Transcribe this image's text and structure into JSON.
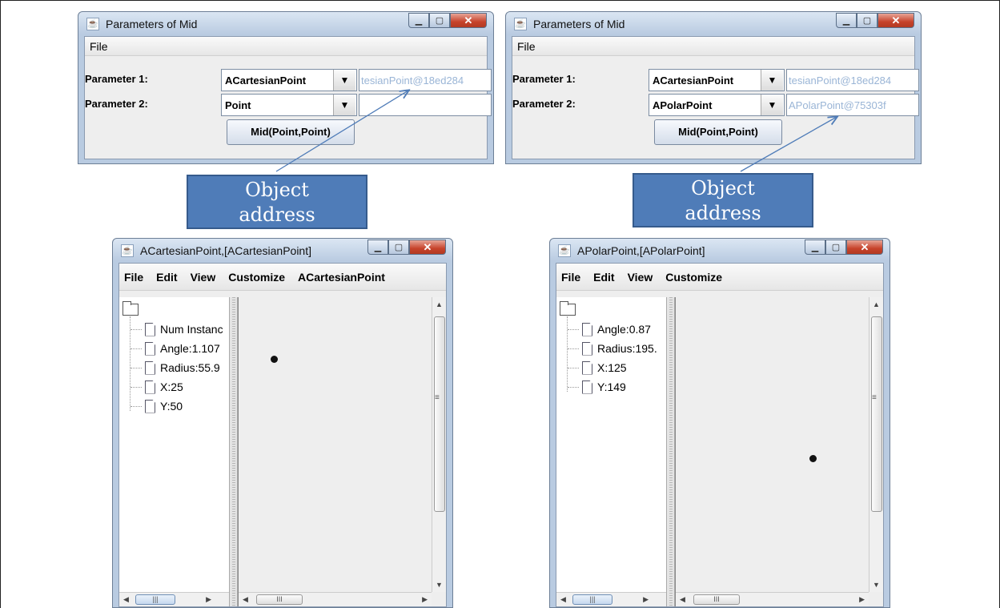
{
  "left_param_window": {
    "title": "Parameters of Mid",
    "menu": [
      "File"
    ],
    "param1_label": "Parameter 1:",
    "param1_value": "ACartesianPoint",
    "param1_address": "tesianPoint@18ed284",
    "param2_label": "Parameter 2:",
    "param2_value": "Point",
    "param2_address": "",
    "action_button": "Mid(Point,Point)"
  },
  "right_param_window": {
    "title": "Parameters of Mid",
    "menu": [
      "File"
    ],
    "param1_label": "Parameter 1:",
    "param1_value": "ACartesianPoint",
    "param1_address": "tesianPoint@18ed284",
    "param2_label": "Parameter 2:",
    "param2_value": "APolarPoint",
    "param2_address": "APolarPoint@75303f",
    "action_button": "Mid(Point,Point)"
  },
  "callouts": {
    "left": [
      "Object",
      "address"
    ],
    "right": [
      "Object",
      "address"
    ]
  },
  "cartesian_window": {
    "title": "ACartesianPoint,[ACartesianPoint]",
    "menu": [
      "File",
      "Edit",
      "View",
      "Customize",
      "ACartesianPoint"
    ],
    "tree_items": [
      "Num Instanc",
      "Angle:1.107",
      "Radius:55.9",
      "X:25",
      "Y:50"
    ]
  },
  "polar_window": {
    "title": "APolarPoint,[APolarPoint]",
    "menu": [
      "File",
      "Edit",
      "View",
      "Customize"
    ],
    "tree_items": [
      "Angle:0.87",
      "Radius:195.",
      "X:125",
      "Y:149"
    ]
  },
  "icons": {
    "window_controls": [
      "minimize-icon",
      "maximize-icon",
      "close-icon"
    ],
    "combo_arrow": "chevron-down-icon",
    "tree_leaf": "document-icon",
    "tree_root": "folder-icon"
  }
}
